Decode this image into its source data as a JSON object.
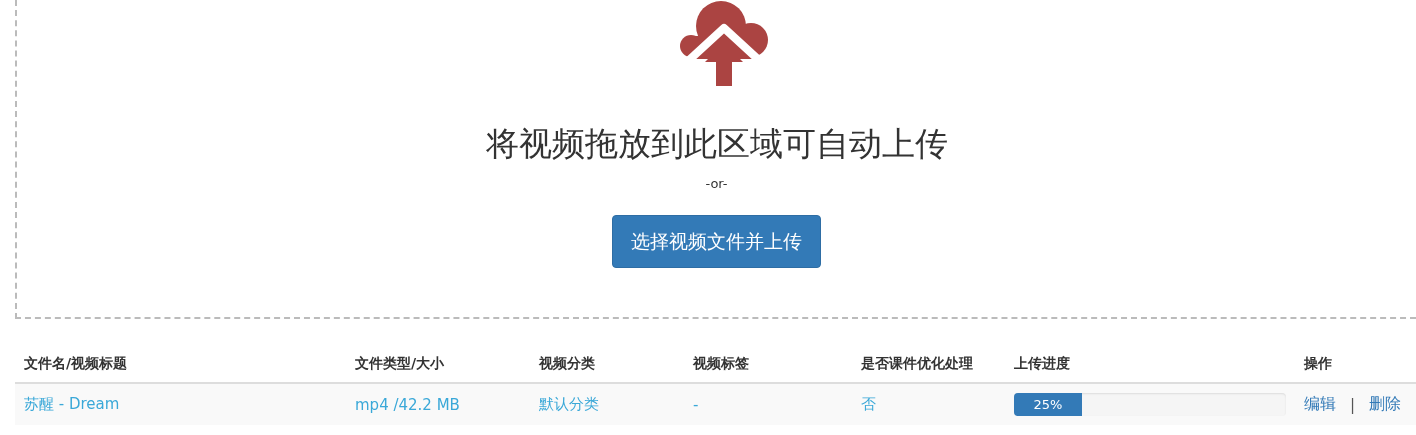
{
  "dropzone": {
    "title": "将视频拖放到此区域可自动上传",
    "separator": "-or-",
    "button": "选择视频文件并上传"
  },
  "table": {
    "columns": [
      "文件名/视频标题",
      "文件类型/大小",
      "视频分类",
      "视频标签",
      "是否课件优化处理",
      "上传进度",
      "操作"
    ],
    "rows": [
      {
        "title": "苏醒 - Dream",
        "type_size": "mp4 /42.2 MB",
        "category": "默认分类",
        "tags": "-",
        "optimized": "否",
        "level": 0.25,
        "progress": "25%",
        "actions": [
          "编辑",
          "删除"
        ],
        "action_separator": "|"
      }
    ]
  }
}
